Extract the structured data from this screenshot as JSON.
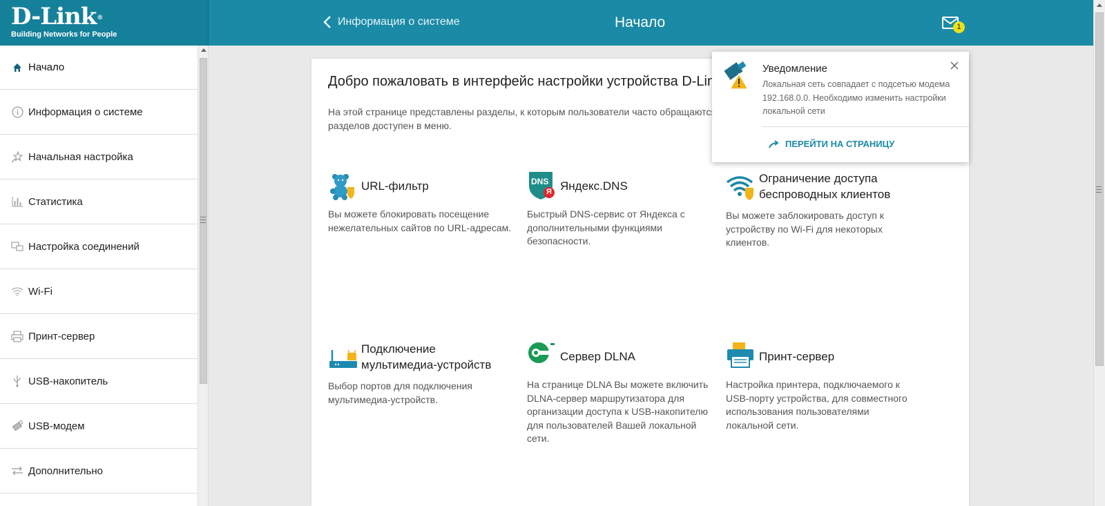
{
  "header": {
    "logo_title": "D-Link",
    "logo_mark": "®",
    "logo_subtitle": "Building Networks for People",
    "back_label": "Информация о системе",
    "title": "Начало",
    "mail_count": "1",
    "bg_color": "#1a8aa6"
  },
  "sidebar": {
    "items": [
      {
        "label": "Начало",
        "icon": "home-icon"
      },
      {
        "label": "Информация о системе",
        "icon": "info-icon"
      },
      {
        "label": "Начальная настройка",
        "icon": "wizard-star-icon"
      },
      {
        "label": "Статистика",
        "icon": "bar-chart-icon"
      },
      {
        "label": "Настройка соединений",
        "icon": "connections-icon"
      },
      {
        "label": "Wi-Fi",
        "icon": "wifi-icon"
      },
      {
        "label": "Принт-сервер",
        "icon": "printer-icon"
      },
      {
        "label": "USB-накопитель",
        "icon": "usb-icon"
      },
      {
        "label": "USB-модем",
        "icon": "usb-modem-icon"
      },
      {
        "label": "Дополнительно",
        "icon": "advanced-arrows-icon"
      }
    ]
  },
  "main": {
    "welcome": "Добро пожаловать в интерфейс настройки устройства D-Link",
    "intro": "На этой странице представлены разделы, к которым пользователи часто обращаются разделов доступен в меню.",
    "intro_line1": "На этой странице представлены разделы, к которым пользователи часто обращаются",
    "intro_line2": "разделов доступен в меню.",
    "tiles": [
      {
        "title": "URL-фильтр",
        "desc": "Вы можете блокировать посещение нежелательных сайтов по URL-адресам."
      },
      {
        "title": "Яндекс.DNS",
        "desc": "Быстрый DNS-сервис от Яндекса с дополнительными функциями безопасности."
      },
      {
        "title": "Ограничение доступа беспроводных клиентов",
        "desc": "Вы можете заблокировать доступ к устройству по Wi-Fi для некоторых клиентов."
      },
      {
        "title": "Подключение мультимедиа-устройств",
        "desc": "Выбор портов для подключения мультимедиа-устройств."
      },
      {
        "title": "Сервер DLNA",
        "desc": "На странице DLNA Вы можете включить DLNA-сервер маршрутизатора для организации доступа к USB-накопителю для пользователей Вашей локальной сети."
      },
      {
        "title": "Принт-сервер",
        "desc": "Настройка принтера, подключаемого к USB-порту устройства, для совместного использования пользователями локальной сети."
      }
    ],
    "dns_badge": "DNS",
    "yandex_badge": "Я"
  },
  "notification": {
    "title": "Уведомление",
    "text": "Локальная сеть совпадает с подсетью модема 192.168.0.0. Необходимо изменить настройки локальной сети",
    "link": "ПЕРЕЙТИ НА СТРАНИЦУ"
  }
}
